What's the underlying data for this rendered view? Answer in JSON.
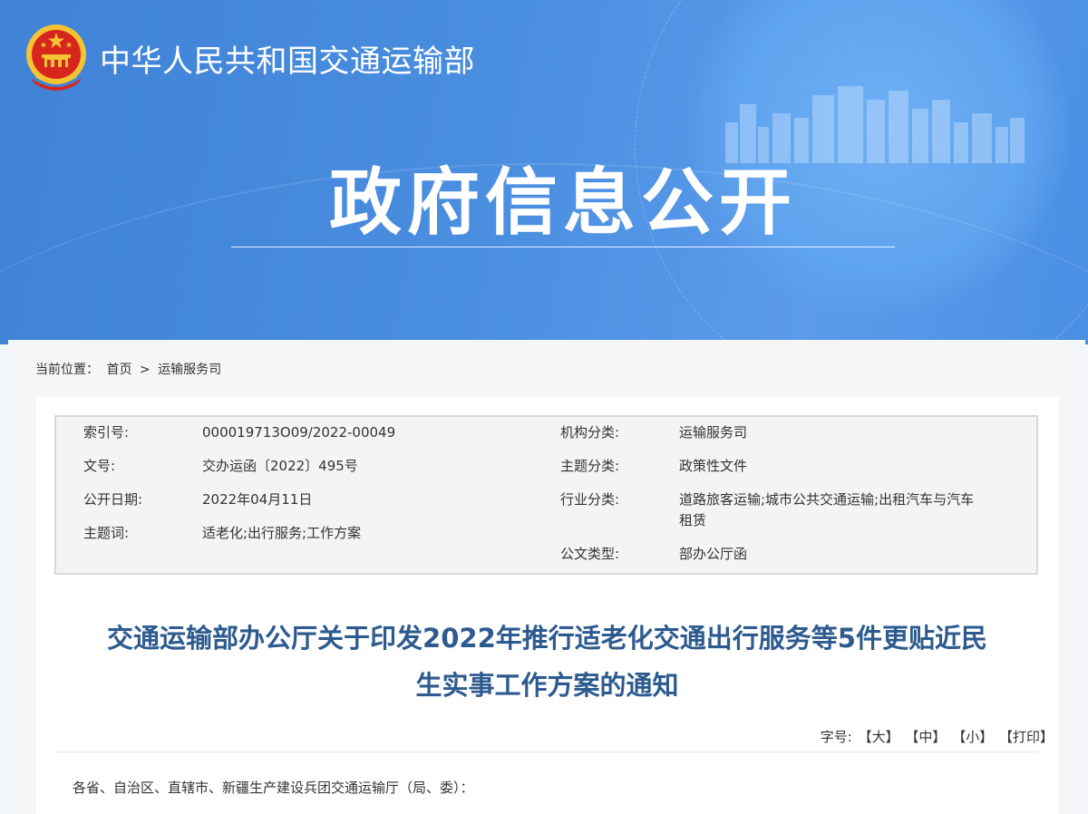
{
  "header": {
    "ministry_name": "中华人民共和国交通运输部",
    "section_title": "政府信息公开"
  },
  "breadcrumb": {
    "label": "当前位置：",
    "home": "首页",
    "separator": ">",
    "current": "运输服务司"
  },
  "meta": {
    "left": [
      {
        "label": "索引号:",
        "value": "000019713O09/2022-00049"
      },
      {
        "label": "文号:",
        "value": "交办运函〔2022〕495号"
      },
      {
        "label": "公开日期:",
        "value": "2022年04月11日"
      },
      {
        "label": "主题词:",
        "value": "适老化;出行服务;工作方案"
      }
    ],
    "right": [
      {
        "label": "机构分类:",
        "value": "运输服务司"
      },
      {
        "label": "主题分类:",
        "value": "政策性文件"
      },
      {
        "label": "行业分类:",
        "value_line1": "道路旅客运输;城市公共交通运输;出租汽车与汽车",
        "value_line2": "租赁"
      },
      {
        "label": "公文类型:",
        "value": "部办公厅函"
      }
    ]
  },
  "document": {
    "title_line1": "交通运输部办公厅关于印发2022年推行适老化交通出行服务等5件更贴近民",
    "title_line2": "生实事工作方案的通知",
    "salutation": "各省、自治区、直辖市、新疆生产建设兵团交通运输厅（局、委）："
  },
  "font_controls": {
    "label": "字号:",
    "large": "【大】",
    "medium": "【中】",
    "small": "【小】",
    "print": "【打印】"
  },
  "colors": {
    "banner_blue": "#4a8ee0",
    "title_blue": "#2d5b8f",
    "emblem_red": "#d7261e",
    "emblem_gold": "#f3c334"
  }
}
